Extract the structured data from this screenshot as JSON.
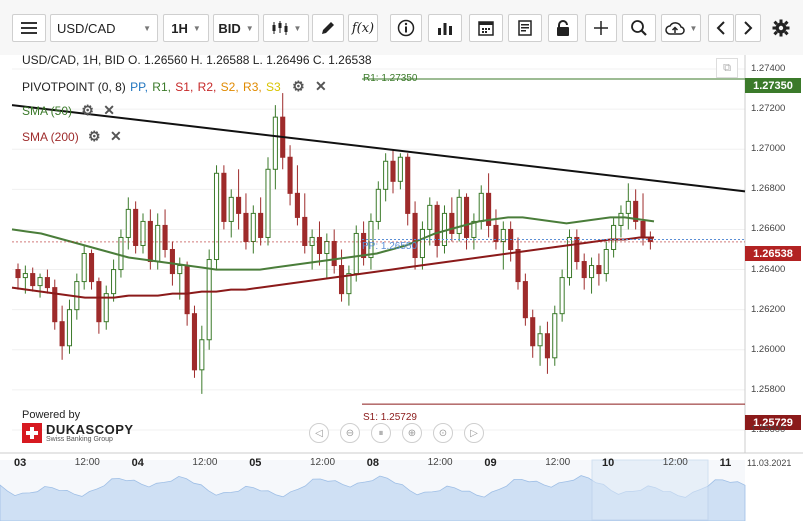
{
  "toolbar": {
    "symbol": "USD/CAD",
    "timeframe": "1H",
    "side": "BID",
    "fx_label": "f(x)"
  },
  "legend": {
    "ohlc": "USD/CAD, 1H, BID   O. 1.26560 H. 1.26588 L. 1.26496 C. 1.26538",
    "pivot_prefix": "PIVOTPOINT (0, 8)",
    "pivot_items": [
      "PP,",
      "R1,",
      "S1,",
      "R2,",
      "S2,",
      "R3,",
      "S3"
    ],
    "pivot_colors": [
      "#1e73be",
      "#3b7a2a",
      "#c62828",
      "#c62828",
      "#e08a00",
      "#e08a00",
      "#d8c400"
    ],
    "sma50": "SMA (50)",
    "sma200": "SMA (200)"
  },
  "levels": {
    "r1_label": "R1: 1.27350",
    "r1_tag": "1.27350",
    "pp_label": "PP: 1.26550",
    "current_tag": "1.26538",
    "s1_label": "S1: 1.25729",
    "s1_tag": "1.25729"
  },
  "colors": {
    "bull": "#3b7a2a",
    "bear": "#9e2b2b",
    "sma50": "#4a7d3a",
    "sma200": "#8b1a1a",
    "trendline": "#111111",
    "r1": "#3b7a2a",
    "s1": "#8b1a1a",
    "pp": "#5b8fd6"
  },
  "y_axis": [
    "1.27400",
    "1.27200",
    "1.27000",
    "1.26800",
    "1.26600",
    "1.26400",
    "1.26200",
    "1.26000",
    "1.25800",
    "1.25600"
  ],
  "x_axis": [
    {
      "text": "03",
      "bold": true
    },
    {
      "text": "12:00",
      "bold": false
    },
    {
      "text": "04",
      "bold": true
    },
    {
      "text": "12:00",
      "bold": false
    },
    {
      "text": "05",
      "bold": true
    },
    {
      "text": "12:00",
      "bold": false
    },
    {
      "text": "08",
      "bold": true
    },
    {
      "text": "12:00",
      "bold": false
    },
    {
      "text": "09",
      "bold": true
    },
    {
      "text": "12:00",
      "bold": false
    },
    {
      "text": "10",
      "bold": true
    },
    {
      "text": "12:00",
      "bold": false
    },
    {
      "text": "11",
      "bold": true
    }
  ],
  "date_stamp": "11.03.2021",
  "brand": {
    "powered": "Powered by",
    "name": "DUKASCOPY",
    "sub": "Swiss Banking Group"
  },
  "chart_data": {
    "type": "candlestick",
    "title": "USD/CAD, 1H, BID",
    "ylim": [
      1.2555,
      1.2745
    ],
    "candles": [
      {
        "o": 1.264,
        "h": 1.2643,
        "l": 1.263,
        "c": 1.2636
      },
      {
        "o": 1.2636,
        "h": 1.2642,
        "l": 1.2628,
        "c": 1.2638
      },
      {
        "o": 1.2638,
        "h": 1.2641,
        "l": 1.2629,
        "c": 1.2632
      },
      {
        "o": 1.2632,
        "h": 1.2638,
        "l": 1.2626,
        "c": 1.2636
      },
      {
        "o": 1.2636,
        "h": 1.264,
        "l": 1.2628,
        "c": 1.2631
      },
      {
        "o": 1.2631,
        "h": 1.2635,
        "l": 1.261,
        "c": 1.2614
      },
      {
        "o": 1.2614,
        "h": 1.2622,
        "l": 1.2595,
        "c": 1.2602
      },
      {
        "o": 1.2602,
        "h": 1.2625,
        "l": 1.2598,
        "c": 1.262
      },
      {
        "o": 1.262,
        "h": 1.2638,
        "l": 1.2615,
        "c": 1.2634
      },
      {
        "o": 1.2634,
        "h": 1.2652,
        "l": 1.263,
        "c": 1.2648
      },
      {
        "o": 1.2648,
        "h": 1.265,
        "l": 1.263,
        "c": 1.2634
      },
      {
        "o": 1.2634,
        "h": 1.2636,
        "l": 1.2608,
        "c": 1.2614
      },
      {
        "o": 1.2614,
        "h": 1.2632,
        "l": 1.261,
        "c": 1.2628
      },
      {
        "o": 1.2628,
        "h": 1.2645,
        "l": 1.2624,
        "c": 1.264
      },
      {
        "o": 1.264,
        "h": 1.266,
        "l": 1.2636,
        "c": 1.2656
      },
      {
        "o": 1.2656,
        "h": 1.2676,
        "l": 1.265,
        "c": 1.267
      },
      {
        "o": 1.267,
        "h": 1.2674,
        "l": 1.2648,
        "c": 1.2652
      },
      {
        "o": 1.2652,
        "h": 1.2668,
        "l": 1.2648,
        "c": 1.2664
      },
      {
        "o": 1.2664,
        "h": 1.267,
        "l": 1.264,
        "c": 1.2644
      },
      {
        "o": 1.2644,
        "h": 1.2668,
        "l": 1.264,
        "c": 1.2662
      },
      {
        "o": 1.2662,
        "h": 1.267,
        "l": 1.2646,
        "c": 1.265
      },
      {
        "o": 1.265,
        "h": 1.2654,
        "l": 1.2632,
        "c": 1.2638
      },
      {
        "o": 1.2638,
        "h": 1.2646,
        "l": 1.2625,
        "c": 1.2642
      },
      {
        "o": 1.2642,
        "h": 1.2644,
        "l": 1.2612,
        "c": 1.2618
      },
      {
        "o": 1.2618,
        "h": 1.2622,
        "l": 1.2586,
        "c": 1.259
      },
      {
        "o": 1.259,
        "h": 1.2612,
        "l": 1.2578,
        "c": 1.2605
      },
      {
        "o": 1.2605,
        "h": 1.265,
        "l": 1.26,
        "c": 1.2645
      },
      {
        "o": 1.2645,
        "h": 1.2692,
        "l": 1.264,
        "c": 1.2688
      },
      {
        "o": 1.2688,
        "h": 1.2692,
        "l": 1.266,
        "c": 1.2664
      },
      {
        "o": 1.2664,
        "h": 1.268,
        "l": 1.2656,
        "c": 1.2676
      },
      {
        "o": 1.2676,
        "h": 1.269,
        "l": 1.266,
        "c": 1.2668
      },
      {
        "o": 1.2668,
        "h": 1.2678,
        "l": 1.265,
        "c": 1.2654
      },
      {
        "o": 1.2654,
        "h": 1.2672,
        "l": 1.2648,
        "c": 1.2668
      },
      {
        "o": 1.2668,
        "h": 1.2676,
        "l": 1.2652,
        "c": 1.2656
      },
      {
        "o": 1.2656,
        "h": 1.2696,
        "l": 1.2652,
        "c": 1.269
      },
      {
        "o": 1.269,
        "h": 1.2722,
        "l": 1.268,
        "c": 1.2716
      },
      {
        "o": 1.2716,
        "h": 1.2728,
        "l": 1.269,
        "c": 1.2696
      },
      {
        "o": 1.2696,
        "h": 1.2702,
        "l": 1.2672,
        "c": 1.2678
      },
      {
        "o": 1.2678,
        "h": 1.2692,
        "l": 1.2662,
        "c": 1.2666
      },
      {
        "o": 1.2666,
        "h": 1.2678,
        "l": 1.2648,
        "c": 1.2652
      },
      {
        "o": 1.2652,
        "h": 1.266,
        "l": 1.264,
        "c": 1.2656
      },
      {
        "o": 1.2656,
        "h": 1.2664,
        "l": 1.2642,
        "c": 1.2648
      },
      {
        "o": 1.2648,
        "h": 1.2658,
        "l": 1.2636,
        "c": 1.2654
      },
      {
        "o": 1.2654,
        "h": 1.266,
        "l": 1.2638,
        "c": 1.2642
      },
      {
        "o": 1.2642,
        "h": 1.265,
        "l": 1.2624,
        "c": 1.2628
      },
      {
        "o": 1.2628,
        "h": 1.2642,
        "l": 1.2622,
        "c": 1.2638
      },
      {
        "o": 1.2638,
        "h": 1.2662,
        "l": 1.2634,
        "c": 1.2658
      },
      {
        "o": 1.2658,
        "h": 1.2664,
        "l": 1.2642,
        "c": 1.2646
      },
      {
        "o": 1.2646,
        "h": 1.2668,
        "l": 1.264,
        "c": 1.2664
      },
      {
        "o": 1.2664,
        "h": 1.2684,
        "l": 1.266,
        "c": 1.268
      },
      {
        "o": 1.268,
        "h": 1.2698,
        "l": 1.2674,
        "c": 1.2694
      },
      {
        "o": 1.2694,
        "h": 1.27,
        "l": 1.2678,
        "c": 1.2684
      },
      {
        "o": 1.2684,
        "h": 1.2698,
        "l": 1.268,
        "c": 1.2696
      },
      {
        "o": 1.2696,
        "h": 1.2698,
        "l": 1.2662,
        "c": 1.2668
      },
      {
        "o": 1.2668,
        "h": 1.2674,
        "l": 1.264,
        "c": 1.2646
      },
      {
        "o": 1.2646,
        "h": 1.2664,
        "l": 1.264,
        "c": 1.266
      },
      {
        "o": 1.266,
        "h": 1.2676,
        "l": 1.2652,
        "c": 1.2672
      },
      {
        "o": 1.2672,
        "h": 1.2674,
        "l": 1.2646,
        "c": 1.2652
      },
      {
        "o": 1.2652,
        "h": 1.2672,
        "l": 1.2648,
        "c": 1.2668
      },
      {
        "o": 1.2668,
        "h": 1.2676,
        "l": 1.2654,
        "c": 1.2658
      },
      {
        "o": 1.2658,
        "h": 1.268,
        "l": 1.2654,
        "c": 1.2676
      },
      {
        "o": 1.2676,
        "h": 1.2678,
        "l": 1.265,
        "c": 1.2656
      },
      {
        "o": 1.2656,
        "h": 1.2668,
        "l": 1.265,
        "c": 1.2664
      },
      {
        "o": 1.2664,
        "h": 1.2682,
        "l": 1.266,
        "c": 1.2678
      },
      {
        "o": 1.2678,
        "h": 1.2688,
        "l": 1.2656,
        "c": 1.2662
      },
      {
        "o": 1.2662,
        "h": 1.267,
        "l": 1.265,
        "c": 1.2654
      },
      {
        "o": 1.2654,
        "h": 1.2664,
        "l": 1.264,
        "c": 1.266
      },
      {
        "o": 1.266,
        "h": 1.2664,
        "l": 1.2644,
        "c": 1.265
      },
      {
        "o": 1.265,
        "h": 1.2656,
        "l": 1.263,
        "c": 1.2634
      },
      {
        "o": 1.2634,
        "h": 1.2638,
        "l": 1.2612,
        "c": 1.2616
      },
      {
        "o": 1.2616,
        "h": 1.262,
        "l": 1.2596,
        "c": 1.2602
      },
      {
        "o": 1.2602,
        "h": 1.2612,
        "l": 1.2592,
        "c": 1.2608
      },
      {
        "o": 1.2608,
        "h": 1.2614,
        "l": 1.2588,
        "c": 1.2596
      },
      {
        "o": 1.2596,
        "h": 1.2622,
        "l": 1.2592,
        "c": 1.2618
      },
      {
        "o": 1.2618,
        "h": 1.264,
        "l": 1.2614,
        "c": 1.2636
      },
      {
        "o": 1.2636,
        "h": 1.266,
        "l": 1.2632,
        "c": 1.2656
      },
      {
        "o": 1.2656,
        "h": 1.266,
        "l": 1.264,
        "c": 1.2644
      },
      {
        "o": 1.2644,
        "h": 1.2648,
        "l": 1.263,
        "c": 1.2636
      },
      {
        "o": 1.2636,
        "h": 1.2646,
        "l": 1.2628,
        "c": 1.2642
      },
      {
        "o": 1.2642,
        "h": 1.2648,
        "l": 1.2632,
        "c": 1.2638
      },
      {
        "o": 1.2638,
        "h": 1.2654,
        "l": 1.2634,
        "c": 1.265
      },
      {
        "o": 1.265,
        "h": 1.2666,
        "l": 1.2646,
        "c": 1.2662
      },
      {
        "o": 1.2662,
        "h": 1.2672,
        "l": 1.2656,
        "c": 1.2668
      },
      {
        "o": 1.2668,
        "h": 1.2683,
        "l": 1.266,
        "c": 1.2674
      },
      {
        "o": 1.2674,
        "h": 1.268,
        "l": 1.266,
        "c": 1.2664
      },
      {
        "o": 1.2664,
        "h": 1.2678,
        "l": 1.2652,
        "c": 1.2656
      },
      {
        "o": 1.2656,
        "h": 1.2659,
        "l": 1.265,
        "c": 1.2654
      }
    ],
    "sma50": [
      1.266,
      1.2659,
      1.2658,
      1.2656,
      1.2654,
      1.2652,
      1.265,
      1.2648,
      1.2646,
      1.2645,
      1.2644,
      1.2643,
      1.2642,
      1.2641,
      1.264,
      1.264,
      1.264,
      1.264,
      1.2641,
      1.2642,
      1.2643,
      1.2644,
      1.2645,
      1.2646,
      1.2647,
      1.2648,
      1.265,
      1.2652,
      1.2655,
      1.2658,
      1.266,
      1.2662,
      1.2664,
      1.2665,
      1.2666,
      1.2666,
      1.2665,
      1.2664,
      1.2663,
      1.2664,
      1.2665,
      1.2666,
      1.2666,
      1.2665,
      1.2664
    ],
    "sma200": [
      1.2631,
      1.263,
      1.2629,
      1.2628,
      1.2627,
      1.2626,
      1.2626,
      1.2626,
      1.2627,
      1.2627,
      1.2627,
      1.2628,
      1.2628,
      1.2629,
      1.2629,
      1.263,
      1.263,
      1.2631,
      1.2632,
      1.2633,
      1.2634,
      1.2635,
      1.2636,
      1.2637,
      1.2638,
      1.2639,
      1.264,
      1.2641,
      1.2642,
      1.2643,
      1.2644,
      1.2645,
      1.2646,
      1.2647,
      1.2648,
      1.2649,
      1.265,
      1.2651,
      1.2652,
      1.2653,
      1.2654,
      1.2655,
      1.2655,
      1.2656,
      1.2656
    ],
    "trendline": [
      1.2722,
      1.2679
    ],
    "r1": 1.2735,
    "pp": 1.2655,
    "s1": 1.25729,
    "last_close": 1.26538
  }
}
